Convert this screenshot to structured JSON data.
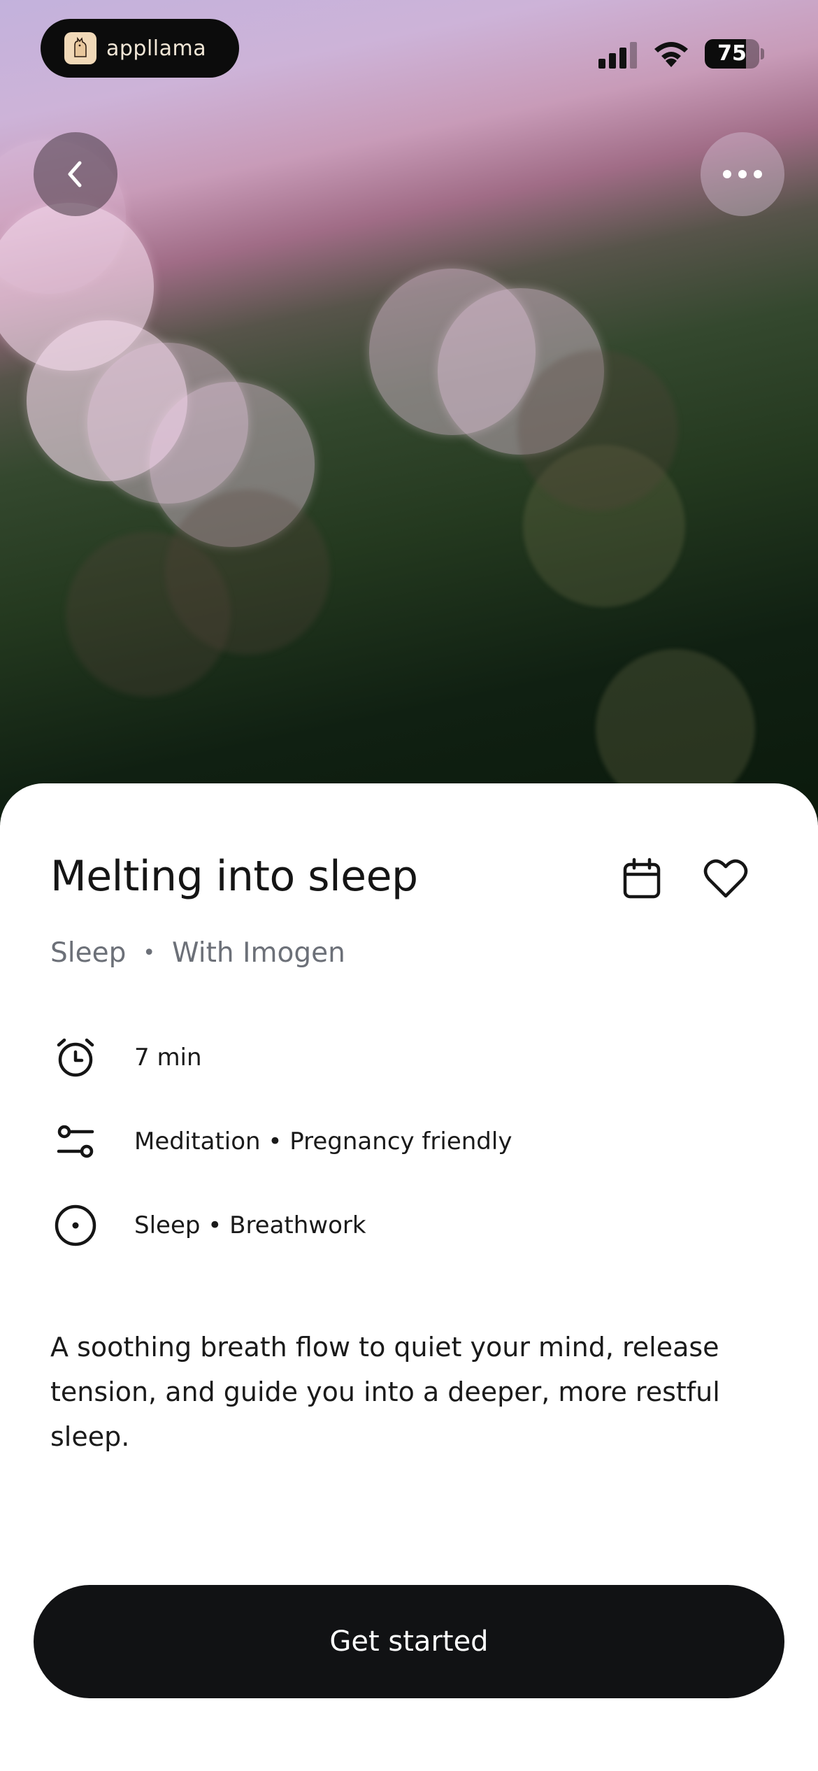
{
  "status_bar": {
    "app_name": "appllama",
    "battery_level": 75,
    "battery_label": "75"
  },
  "header": {
    "back_icon": "chevron-left-icon",
    "more_icon": "ellipsis-icon"
  },
  "session": {
    "title": "Melting into sleep",
    "category": "Sleep",
    "separator": "•",
    "instructor": "With Imogen",
    "details": [
      {
        "icon": "alarm-clock-icon",
        "text": "7 min"
      },
      {
        "icon": "sliders-icon",
        "text": "Meditation • Pregnancy friendly"
      },
      {
        "icon": "target-icon",
        "text": "Sleep • Breathwork"
      }
    ],
    "description": "A soothing breath flow to quiet your mind, release tension, and guide you into a deeper, more restful sleep."
  },
  "actions": {
    "calendar_icon": "calendar-icon",
    "favorite_icon": "heart-icon",
    "cta_label": "Get started"
  }
}
